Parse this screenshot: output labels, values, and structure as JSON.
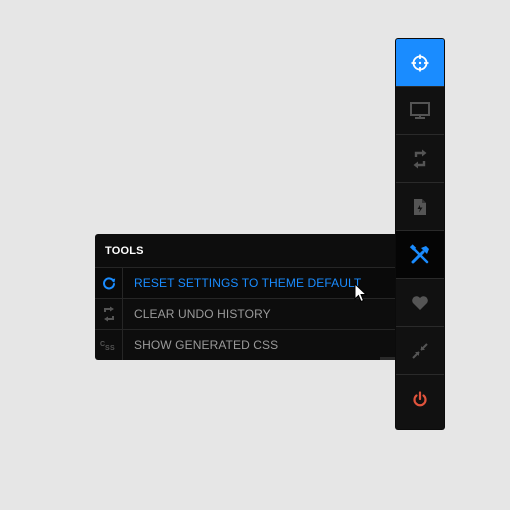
{
  "toolbar": {
    "buttons": [
      {
        "name": "target",
        "icon": "crosshair-icon",
        "state": "active",
        "color": "#ffffff"
      },
      {
        "name": "display",
        "icon": "monitor-icon",
        "state": "normal",
        "color": "#555555"
      },
      {
        "name": "sync",
        "icon": "sync-arrows-icon",
        "state": "normal",
        "color": "#555555"
      },
      {
        "name": "document",
        "icon": "document-icon",
        "state": "normal",
        "color": "#555555"
      },
      {
        "name": "tools",
        "icon": "tools-icon",
        "state": "selected",
        "color": "#1a8cff"
      },
      {
        "name": "favorite",
        "icon": "heart-icon",
        "state": "normal",
        "color": "#555555"
      },
      {
        "name": "collapse",
        "icon": "collapse-arrows-icon",
        "state": "normal",
        "color": "#555555"
      },
      {
        "name": "power",
        "icon": "power-icon",
        "state": "normal",
        "color": "#e0533c"
      }
    ]
  },
  "tools_panel": {
    "title": "TOOLS",
    "items": [
      {
        "label": "RESET SETTINGS TO THEME DEFAULT",
        "icon": "refresh-icon",
        "active": true
      },
      {
        "label": "CLEAR UNDO HISTORY",
        "icon": "exchange-icon",
        "active": false
      },
      {
        "label": "SHOW GENERATED CSS",
        "icon": "css-icon",
        "active": false
      }
    ]
  },
  "colors": {
    "accent": "#1a8cff",
    "power": "#e0533c",
    "background": "#e6e6e6",
    "panel": "#0d0d0d"
  }
}
